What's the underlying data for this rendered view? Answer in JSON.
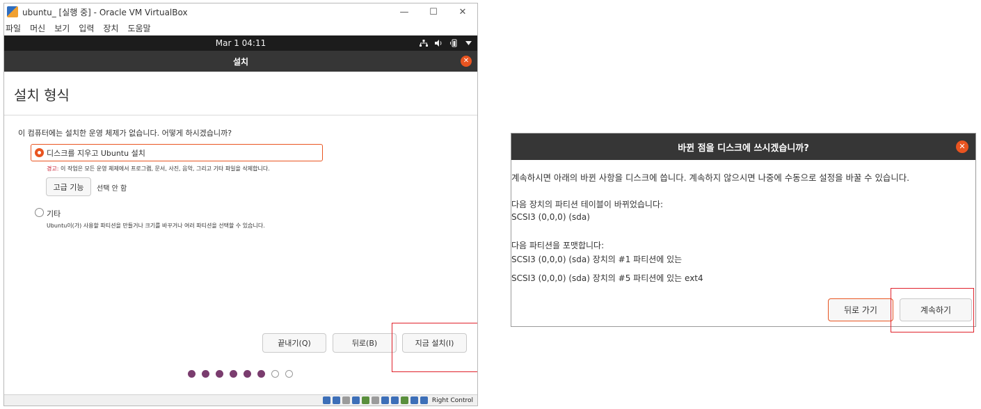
{
  "vbox": {
    "title": "ubuntu_ [실행 중] - Oracle VM VirtualBox",
    "win_controls": [
      "—",
      "☐",
      "✕"
    ],
    "menu": [
      "파일",
      "머신",
      "보기",
      "입력",
      "장치",
      "도움말"
    ],
    "hostkey": "Right Control"
  },
  "ubuntu": {
    "clock": "Mar 1  04:11",
    "tray_icons": [
      "network-icon",
      "volume-icon",
      "battery-icon",
      "dropdown-icon"
    ]
  },
  "installer": {
    "header_title": "설치",
    "page_title": "설치 형식",
    "question": "이 컴퓨터에는 설치한 운영 체제가 없습니다. 어떻게 하시겠습니까?",
    "option_erase": "디스크를 지우고 Ubuntu 설치",
    "warning_prefix": "경고:",
    "warning_text": " 이 작업은 모든 운영 체제에서 프로그램, 문서, 사진, 음악, 그리고 기타 파일을 삭제합니다.",
    "advanced_button": "고급 기능",
    "advanced_status": "선택 안 함",
    "option_other": "기타",
    "option_other_desc": "Ubuntu이(가) 사용할 파티션을 만들거나 크기를 바꾸거나 여러 파티션을 선택할 수 있습니다.",
    "btn_quit": "끝내기(Q)",
    "btn_back": "뒤로(B)",
    "btn_install": "지금 설치(I)",
    "progress_steps_done": 6,
    "progress_steps_total": 8
  },
  "dialog": {
    "title": "바뀐 점을 디스크에 쓰시겠습니까?",
    "line1": "계속하시면 아래의 바뀐 사항을 디스크에 씁니다. 계속하지 않으시면 나중에 수동으로 설정을 바꿀 수 있습니다.",
    "line2": "다음 장치의 파티션 테이블이 바뀌었습니다:",
    "line3": "SCSI3 (0,0,0) (sda)",
    "line4": "다음 파티션을 포맷합니다:",
    "line5": "SCSI3 (0,0,0) (sda) 장치의 #1 파티션에 있는",
    "line6": "SCSI3 (0,0,0) (sda) 장치의 #5 파티션에 있는 ext4",
    "btn_back": "뒤로 가기",
    "btn_continue": "계속하기"
  },
  "colors": {
    "accent": "#e95420",
    "highlight": "#e0202a",
    "header_bg": "#363636",
    "progress_dot": "#7a3c6e"
  }
}
